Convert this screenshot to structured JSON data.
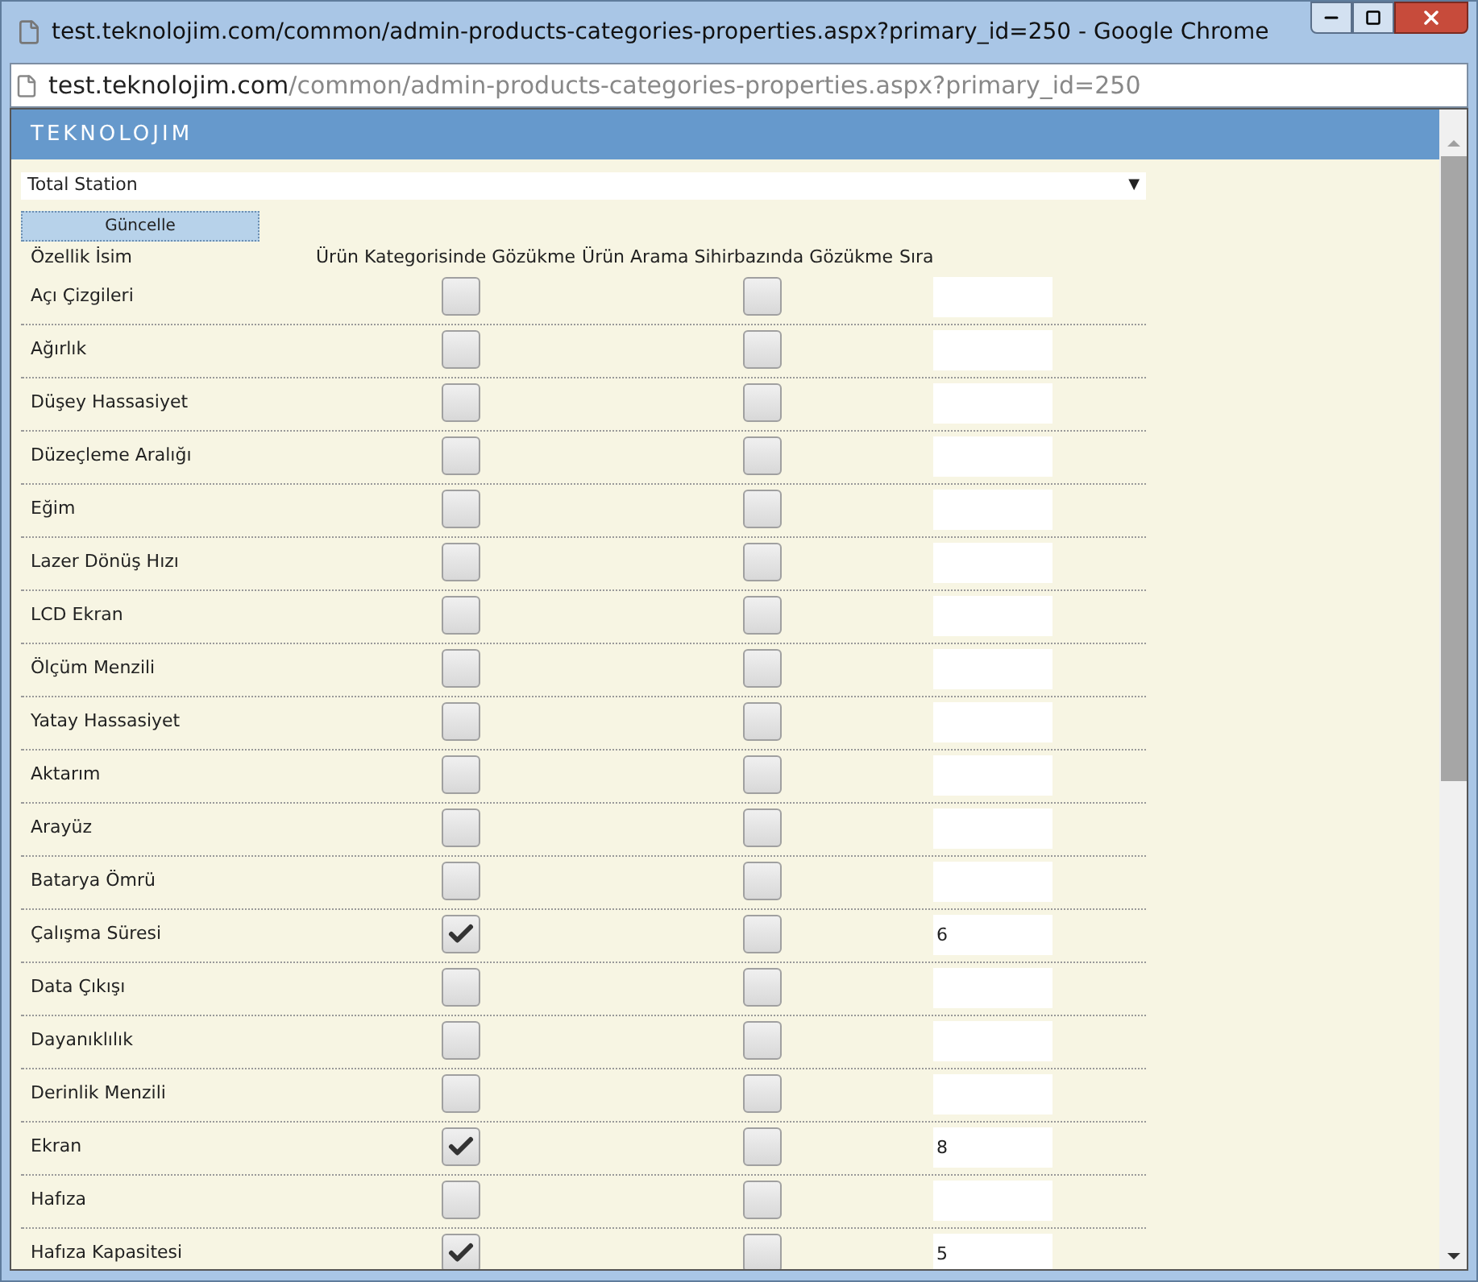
{
  "window": {
    "title": "test.teknolojim.com/common/admin-products-categories-properties.aspx?primary_id=250 - Google Chrome"
  },
  "address_bar": {
    "host": "test.teknolojim.com",
    "path": "/common/admin-products-categories-properties.aspx?primary_id=250"
  },
  "site": {
    "logo": "TEKNOLOJIM"
  },
  "category_select": {
    "value": "Total Station",
    "arrow": "▼"
  },
  "update_button": "Güncelle",
  "table": {
    "columns": [
      "Özellik İsim",
      "Ürün Kategorisinde Gözükme",
      "Ürün Arama Sihirbazında Gözükme",
      "Sıra"
    ],
    "rows": [
      {
        "name": "Açı Çizgileri",
        "in_category": false,
        "in_search": false
      },
      {
        "name": "Ağırlık",
        "in_category": false,
        "in_search": false
      },
      {
        "name": "Düşey Hassasiyet",
        "in_category": false,
        "in_search": false
      },
      {
        "name": "Düzeçleme Aralığı",
        "in_category": false,
        "in_search": false
      },
      {
        "name": "Eğim",
        "in_category": false,
        "in_search": false
      },
      {
        "name": "Lazer Dönüş Hızı",
        "in_category": false,
        "in_search": false
      },
      {
        "name": "LCD Ekran",
        "in_category": false,
        "in_search": false
      },
      {
        "name": "Ölçüm Menzili",
        "in_category": false,
        "in_search": false
      },
      {
        "name": "Yatay Hassasiyet",
        "in_category": false,
        "in_search": false
      },
      {
        "name": "Aktarım",
        "in_category": false,
        "in_search": false
      },
      {
        "name": "Arayüz",
        "in_category": false,
        "in_search": false
      },
      {
        "name": "Batarya Ömrü",
        "in_category": false,
        "in_search": false
      },
      {
        "name": "Çalışma Süresi",
        "in_category": true,
        "in_search": false,
        "order": "6"
      },
      {
        "name": "Data Çıkışı",
        "in_category": false,
        "in_search": false
      },
      {
        "name": "Dayanıklılık",
        "in_category": false,
        "in_search": false
      },
      {
        "name": "Derinlik Menzili",
        "in_category": false,
        "in_search": false
      },
      {
        "name": "Ekran",
        "in_category": true,
        "in_search": false,
        "order": "8"
      },
      {
        "name": "Hafıza",
        "in_category": false,
        "in_search": false
      },
      {
        "name": "Hafıza Kapasitesi",
        "in_category": true,
        "in_search": false,
        "order": "5"
      }
    ]
  }
}
